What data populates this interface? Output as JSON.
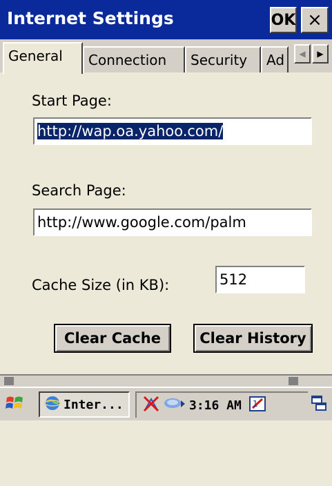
{
  "window": {
    "title": "Internet Settings",
    "ok_label": "OK",
    "close_label": "×"
  },
  "tabs": [
    {
      "label": "General"
    },
    {
      "label": "Connection"
    },
    {
      "label": "Security"
    },
    {
      "label": "Ad"
    }
  ],
  "tab_scroll": {
    "left": "◀",
    "right": "▶"
  },
  "form": {
    "start_page_label": "Start Page:",
    "start_page_value": "http://wap.oa.yahoo.com/",
    "search_page_label": "Search Page:",
    "search_page_value": "http://www.google.com/palm",
    "cache_size_label": "Cache Size (in KB):",
    "cache_size_value": "512"
  },
  "buttons": {
    "clear_cache": "Clear Cache",
    "clear_history": "Clear History"
  },
  "taskbar": {
    "start_icon": "windows-flag-icon",
    "task_label": "Inter...",
    "clock": "3:16 AM",
    "tray_icons": [
      "network-disconnected-icon",
      "connectivity-icon",
      "input-panel-icon"
    ]
  },
  "colors": {
    "titlebar": "#0a2a9c",
    "selection": "#0a246a",
    "face": "#d4d0c8"
  }
}
